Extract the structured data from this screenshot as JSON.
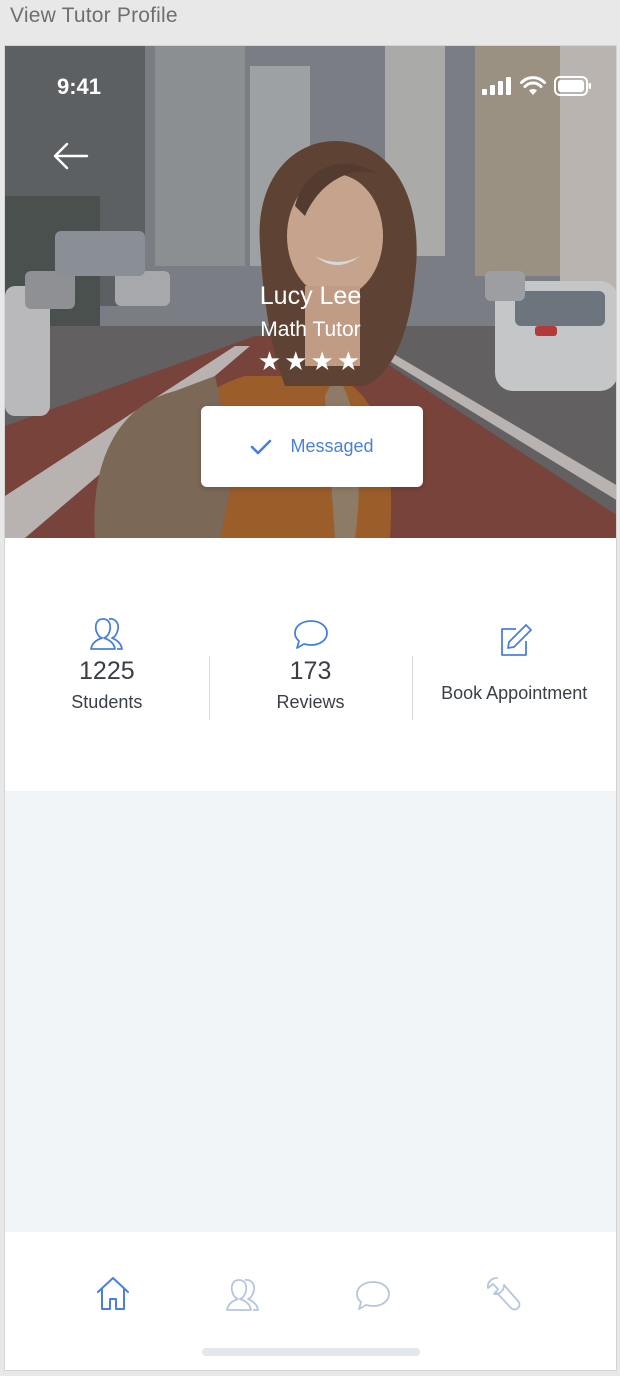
{
  "window": {
    "title": "View Tutor Profile"
  },
  "status_bar": {
    "time": "9:41"
  },
  "profile": {
    "name": "Lucy Lee",
    "subject": "Math Tutor",
    "rating_stars": 4,
    "rating_display": "★★★★",
    "message_status": "Messaged"
  },
  "stats": [
    {
      "count": "1225",
      "label": "Students",
      "icon": "students-icon"
    },
    {
      "count": "173",
      "label": "Reviews",
      "icon": "reviews-icon"
    },
    {
      "label": "Book Appointment",
      "icon": "edit-icon"
    }
  ],
  "tabbar": {
    "items": [
      {
        "icon": "home-icon",
        "active": true
      },
      {
        "icon": "users-icon",
        "active": false
      },
      {
        "icon": "chat-icon",
        "active": false
      },
      {
        "icon": "wrench-icon",
        "active": false
      }
    ]
  },
  "colors": {
    "accent": "#4a80d9",
    "inactive_icon": "#b5c6dd",
    "text_dark": "#3a3f47",
    "grey_background": "#f2f5f8"
  }
}
